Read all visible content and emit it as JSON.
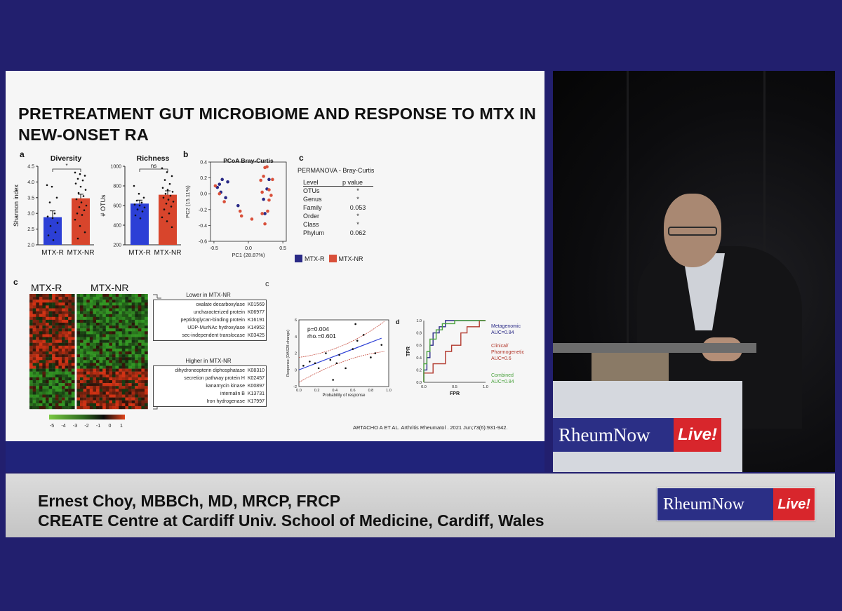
{
  "slide": {
    "title": "PRETREATMENT GUT MICROBIOME AND RESPONSE TO MTX IN NEW-ONSET RA",
    "panel_a_label": "a",
    "panel_b_label": "b",
    "panel_c_top_label": "c",
    "panel_c_heat_label": "c",
    "panel_c_scatter_label": "c",
    "panel_d_label": "d",
    "permanova": {
      "title": "PERMANOVA - Bray-Curtis",
      "col_level": "Level",
      "col_p": "p value",
      "rows": [
        {
          "level": "OTUs",
          "p": "*"
        },
        {
          "level": "Genus",
          "p": "*"
        },
        {
          "level": "Family",
          "p": "0.053"
        },
        {
          "level": "Order",
          "p": "*"
        },
        {
          "level": "Class",
          "p": "*"
        },
        {
          "level": "Phylum",
          "p": "0.062"
        }
      ]
    },
    "legend": {
      "r": "MTX-R",
      "nr": "MTX-NR",
      "r_color": "#2a2a86",
      "nr_color": "#d9503a"
    },
    "heatmap": {
      "col_r": "MTX-R",
      "col_nr": "MTX-NR",
      "lower_title": "Lower in MTX-NR",
      "lower": [
        "oxalate decarboxylase  K01569",
        "uncharacterized protein  K06977",
        "peptidoglycan-binding protein  K16191",
        "UDP-MurNAc hydroxylase  K14952",
        "sec-independent translocase  K03425"
      ],
      "higher_title": "Higher in MTX-NR",
      "higher": [
        "dihydroneopterin diphosphatase  K08310",
        "secretion pathway protein H  K02457",
        "kanamycin kinase  K00897",
        "internalin B  K13731",
        "Iron hydrogenase  K17997"
      ],
      "scale_ticks": [
        "-5",
        "-4",
        "-3",
        "-2",
        "-1",
        "0",
        "1"
      ]
    },
    "citation": "ARTACHO A ET AL. Arthritis Rheumatol . 2021 Jun;73(6):931-942."
  },
  "chart_data": [
    {
      "type": "bar",
      "title": "Diversity",
      "ylabel": "Shannon index",
      "categories": [
        "MTX-R",
        "MTX-NR"
      ],
      "values": [
        2.88,
        3.48
      ],
      "errors": [
        0.2,
        0.13
      ],
      "colors": [
        "#2c3fd6",
        "#d8452c"
      ],
      "ylim": [
        2.0,
        4.5
      ],
      "yticks": [
        "2.0",
        "2.5",
        "3.0",
        "3.5",
        "4.0",
        "4.5"
      ],
      "significance": "*",
      "points": [
        [
          3.9,
          3.85,
          3.5,
          3.35,
          3.0,
          2.9,
          2.85,
          2.7,
          2.6,
          2.4,
          2.3,
          2.15
        ],
        [
          4.3,
          4.25,
          4.2,
          4.1,
          4.05,
          3.95,
          3.85,
          3.75,
          3.65,
          3.55,
          3.45,
          3.35,
          3.25,
          3.2,
          3.1,
          3.0,
          2.95,
          2.8,
          2.6,
          2.4,
          2.2
        ]
      ]
    },
    {
      "type": "bar",
      "title": "Richness",
      "ylabel": "# OTUs",
      "categories": [
        "MTX-R",
        "MTX-NR"
      ],
      "values": [
        620,
        710
      ],
      "errors": [
        35,
        40
      ],
      "colors": [
        "#2c3fd6",
        "#d8452c"
      ],
      "ylim": [
        200,
        1000
      ],
      "yticks": [
        "200",
        "400",
        "600",
        "800",
        "1000"
      ],
      "significance": "ns",
      "points": [
        [
          800,
          720,
          680,
          650,
          630,
          610,
          600,
          580,
          560,
          540,
          500,
          470
        ],
        [
          980,
          940,
          900,
          860,
          820,
          780,
          760,
          740,
          720,
          700,
          680,
          660,
          640,
          620,
          590,
          560,
          520,
          480,
          440,
          380
        ]
      ]
    },
    {
      "type": "scatter",
      "title": "PCoA Bray-Curtis",
      "xlabel": "PC1 (28.87%)",
      "ylabel": "PC2 (15.11%)",
      "xlim": [
        -0.55,
        0.55
      ],
      "ylim": [
        -0.6,
        0.4
      ],
      "xticks": [
        "-0.5",
        "0.0",
        "0.5"
      ],
      "yticks": [
        "0.4",
        "0.2",
        "0.0",
        "-0.2",
        "-0.4",
        "-0.6"
      ],
      "series": [
        {
          "name": "MTX-R",
          "color": "#2a2a86",
          "points": [
            [
              -0.38,
              0.18
            ],
            [
              -0.42,
              0.12
            ],
            [
              -0.45,
              0.08
            ],
            [
              -0.4,
              0.02
            ],
            [
              -0.33,
              -0.05
            ],
            [
              -0.15,
              -0.15
            ],
            [
              0.3,
              0.18
            ],
            [
              0.27,
              0.06
            ],
            [
              0.22,
              -0.07
            ],
            [
              0.24,
              -0.25
            ],
            [
              -0.3,
              0.15
            ]
          ]
        },
        {
          "name": "MTX-NR",
          "color": "#d9503a",
          "points": [
            [
              0.24,
              0.33
            ],
            [
              0.27,
              0.34
            ],
            [
              0.22,
              0.22
            ],
            [
              0.18,
              0.17
            ],
            [
              0.35,
              0.18
            ],
            [
              0.3,
              0.05
            ],
            [
              0.33,
              -0.02
            ],
            [
              0.2,
              0.02
            ],
            [
              0.3,
              -0.08
            ],
            [
              0.28,
              -0.22
            ],
            [
              0.2,
              -0.25
            ],
            [
              0.24,
              -0.38
            ],
            [
              0.05,
              -0.32
            ],
            [
              -0.1,
              -0.28
            ],
            [
              -0.12,
              -0.22
            ],
            [
              -0.48,
              0.1
            ],
            [
              -0.42,
              0.0
            ],
            [
              -0.35,
              -0.1
            ]
          ]
        }
      ]
    },
    {
      "type": "scatter",
      "xlabel": "Probability of response",
      "ylabel": "Response (DAS28 change)",
      "annotation": [
        "p=0.004",
        "rho.=0.601"
      ],
      "xlim": [
        0.0,
        1.0
      ],
      "ylim": [
        -2,
        6
      ],
      "xticks": [
        "0.0",
        "0.2",
        "0.4",
        "0.6",
        "0.8",
        "1.0"
      ],
      "yticks": [
        "-2",
        "0",
        "2",
        "4",
        "6"
      ],
      "points": [
        [
          0.05,
          0.5
        ],
        [
          0.12,
          1.0
        ],
        [
          0.18,
          0.8
        ],
        [
          0.22,
          0.2
        ],
        [
          0.3,
          2.0
        ],
        [
          0.35,
          1.2
        ],
        [
          0.38,
          -1.2
        ],
        [
          0.42,
          0.8
        ],
        [
          0.45,
          1.8
        ],
        [
          0.52,
          0.2
        ],
        [
          0.6,
          2.5
        ],
        [
          0.63,
          5.5
        ],
        [
          0.65,
          3.5
        ],
        [
          0.72,
          4.2
        ],
        [
          0.8,
          1.5
        ],
        [
          0.85,
          2.0
        ],
        [
          0.92,
          3.0
        ]
      ],
      "fit": [
        [
          0.0,
          0.0
        ],
        [
          0.92,
          3.8
        ]
      ]
    },
    {
      "type": "line",
      "xlabel": "FPR",
      "ylabel": "TPR",
      "xlim": [
        0.0,
        1.0
      ],
      "ylim": [
        0.0,
        1.0
      ],
      "xticks": [
        "0.0",
        "0.5",
        "1.0"
      ],
      "yticks": [
        "0.0",
        "0.2",
        "0.4",
        "0.6",
        "0.8",
        "1.0"
      ],
      "series": [
        {
          "name": "Metagenomic",
          "auc": "AUC=0.84",
          "color": "#2a2a86",
          "points": [
            [
              0,
              0
            ],
            [
              0,
              0.2
            ],
            [
              0.05,
              0.2
            ],
            [
              0.05,
              0.4
            ],
            [
              0.1,
              0.4
            ],
            [
              0.1,
              0.6
            ],
            [
              0.15,
              0.6
            ],
            [
              0.15,
              0.8
            ],
            [
              0.25,
              0.8
            ],
            [
              0.25,
              0.9
            ],
            [
              0.35,
              0.9
            ],
            [
              0.35,
              1.0
            ],
            [
              1,
              1
            ]
          ]
        },
        {
          "name": "Clinical/\nPharmogenetic",
          "auc": "AUC=0.6",
          "color": "#b23a2e",
          "points": [
            [
              0,
              0
            ],
            [
              0,
              0.15
            ],
            [
              0.15,
              0.15
            ],
            [
              0.15,
              0.3
            ],
            [
              0.35,
              0.3
            ],
            [
              0.35,
              0.5
            ],
            [
              0.45,
              0.5
            ],
            [
              0.45,
              0.6
            ],
            [
              0.6,
              0.6
            ],
            [
              0.6,
              0.8
            ],
            [
              0.7,
              0.8
            ],
            [
              0.7,
              0.9
            ],
            [
              0.9,
              0.9
            ],
            [
              0.9,
              1.0
            ],
            [
              1,
              1
            ]
          ]
        },
        {
          "name": "Combined",
          "auc": "AUC=0.84",
          "color": "#4aa23e",
          "points": [
            [
              0,
              0
            ],
            [
              0,
              0.3
            ],
            [
              0.05,
              0.3
            ],
            [
              0.05,
              0.5
            ],
            [
              0.1,
              0.5
            ],
            [
              0.1,
              0.7
            ],
            [
              0.2,
              0.7
            ],
            [
              0.2,
              0.85
            ],
            [
              0.3,
              0.85
            ],
            [
              0.3,
              0.95
            ],
            [
              0.5,
              0.95
            ],
            [
              0.5,
              1.0
            ],
            [
              1,
              1
            ]
          ]
        }
      ]
    }
  ],
  "video": {
    "podium_logo_main": "RheumNow",
    "podium_logo_live": "Live!"
  },
  "lower_third": {
    "name": "Ernest Choy, MBBCh, MD, MRCP, FRCP",
    "affiliation": "CREATE Centre at Cardiff Univ. School of Medicine, Cardiff, Wales",
    "logo_main": "RheumNow",
    "logo_live": "Live!"
  }
}
